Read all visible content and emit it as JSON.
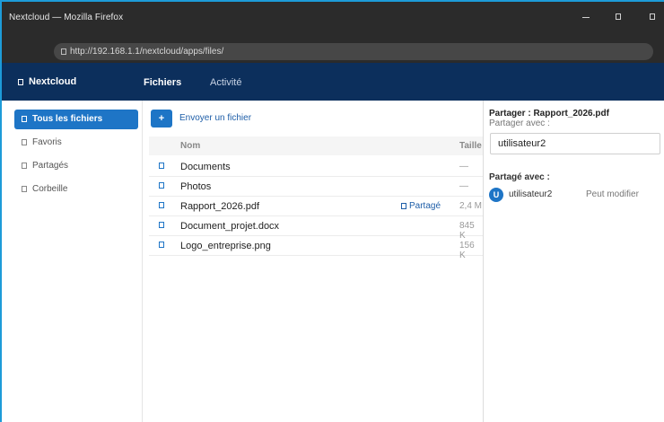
{
  "window": {
    "title": "Nextcloud — Mozilla Firefox",
    "controls": [
      "minimize-icon",
      "maximize-icon",
      "close-icon"
    ]
  },
  "browser": {
    "url": "http://192.168.1.1/nextcloud/apps/files/"
  },
  "app": {
    "brand": "Nextcloud",
    "tabs": [
      {
        "label": "Fichiers",
        "active": true
      },
      {
        "label": "Activité",
        "active": false
      }
    ]
  },
  "sidebar": {
    "items": [
      {
        "label": "Tous les fichiers",
        "active": true,
        "icon": "folder-icon"
      },
      {
        "label": "Favoris",
        "active": false,
        "icon": "star-icon"
      },
      {
        "label": "Partagés",
        "active": false,
        "icon": "share-icon"
      },
      {
        "label": "Corbeille",
        "active": false,
        "icon": "trash-icon"
      }
    ]
  },
  "main": {
    "upload_button": "+",
    "upload_link": "Envoyer un fichier",
    "columns": {
      "name": "Nom",
      "size": "Taille"
    },
    "files": [
      {
        "name": "Documents",
        "size": "—",
        "shared": "",
        "icon": "folder-icon"
      },
      {
        "name": "Photos",
        "size": "—",
        "shared": "",
        "icon": "folder-icon"
      },
      {
        "name": "Rapport_2026.pdf",
        "size": "2,4 M",
        "shared": "Partagé",
        "icon": "file-icon"
      },
      {
        "name": "Document_projet.docx",
        "size": "845 K",
        "shared": "",
        "icon": "file-icon"
      },
      {
        "name": "Logo_entreprise.png",
        "size": "156 K",
        "shared": "",
        "icon": "file-icon"
      }
    ]
  },
  "share_panel": {
    "title": "Partager : Rapport_2026.pdf",
    "share_with_label": "Partager avec :",
    "input_value": "utilisateur2",
    "shared_with_heading": "Partagé avec :",
    "shares": [
      {
        "avatar": "U",
        "user": "utilisateur2",
        "permission": "Peut modifier"
      }
    ]
  },
  "colors": {
    "title_bar": "#2b2b2b",
    "app_header": "#0c2f5c",
    "accent": "#1e75c6",
    "window_border": "#1d9bd8"
  }
}
